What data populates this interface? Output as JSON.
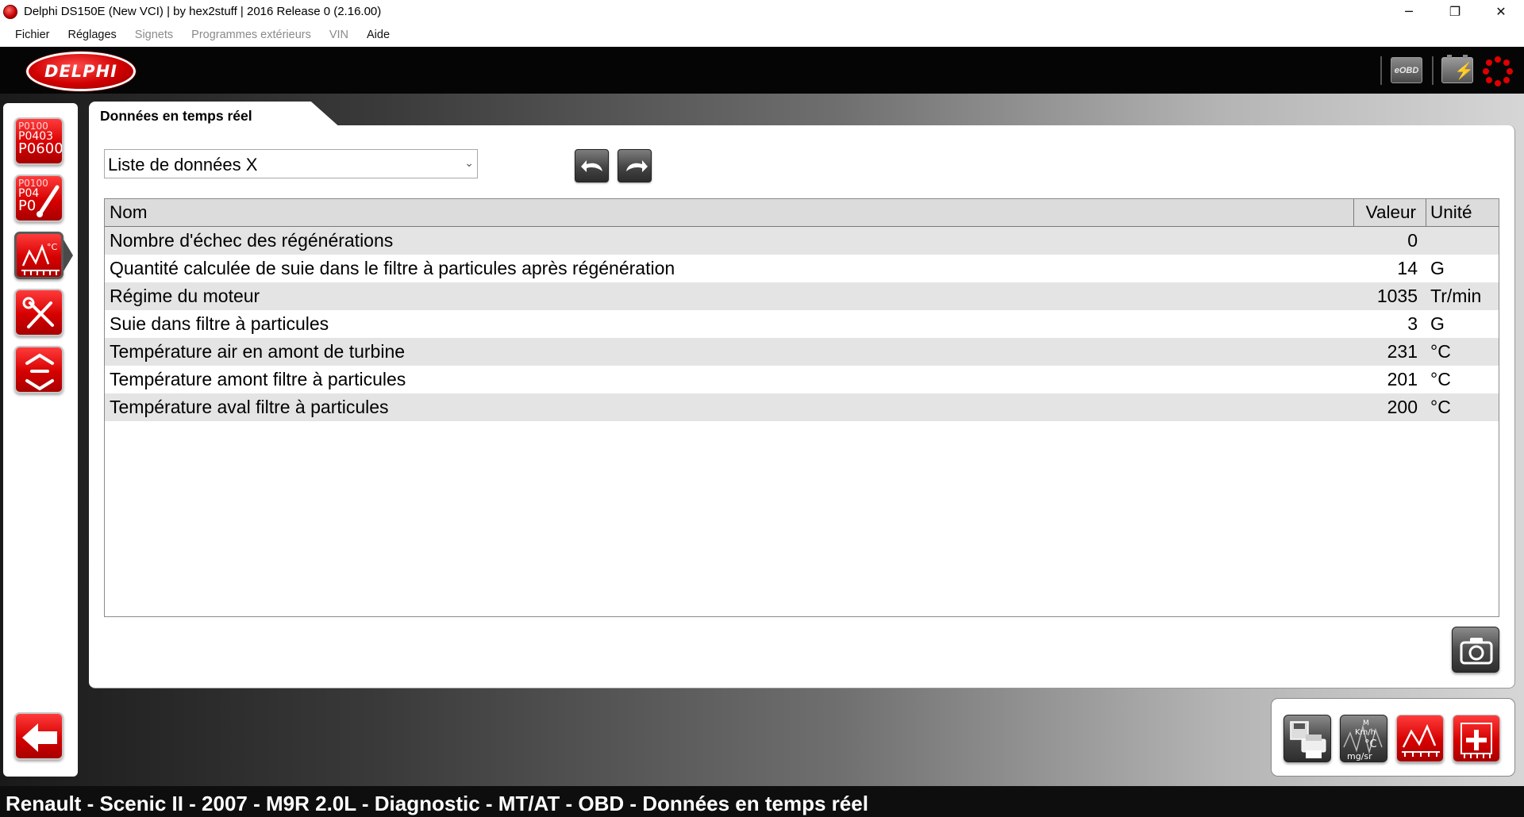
{
  "window": {
    "title": "Delphi DS150E (New VCI) | by hex2stuff | 2016 Release 0 (2.16.00)",
    "controls": {
      "minimize": "─",
      "restore": "❐",
      "close": "✕"
    }
  },
  "menu": {
    "items": [
      {
        "label": "Fichier",
        "enabled": true
      },
      {
        "label": "Réglages",
        "enabled": true
      },
      {
        "label": "Signets",
        "enabled": false
      },
      {
        "label": "Programmes extérieurs",
        "enabled": false
      },
      {
        "label": "VIN",
        "enabled": false
      },
      {
        "label": "Aide",
        "enabled": true
      }
    ]
  },
  "header": {
    "logo_text": "DELPHI",
    "eobd_label": "eOBD",
    "battery_icon": "battery-charging-icon",
    "status_icon": "connection-spinner-icon"
  },
  "sidebar": {
    "items": [
      {
        "name": "read-dtc-button",
        "codes": [
          "P0100",
          "P0403",
          "P0600"
        ],
        "icon": "dtc-codes-icon"
      },
      {
        "name": "clear-dtc-button",
        "codes": [
          "P0100",
          "P04",
          "P0"
        ],
        "icon": "erase-dtc-icon"
      },
      {
        "name": "live-data-button",
        "icon": "live-data-chart-icon",
        "active": true
      },
      {
        "name": "tests-button",
        "icon": "tools-icon"
      },
      {
        "name": "adjustments-button",
        "icon": "adjust-arrows-icon"
      }
    ],
    "back_icon": "back-arrow-icon"
  },
  "content": {
    "tab_label": "Données en temps réel",
    "data_list": {
      "selected": "Liste de données X"
    },
    "table": {
      "headers": {
        "name": "Nom",
        "value": "Valeur",
        "unit": "Unité"
      },
      "rows": [
        {
          "name": "Nombre d'échec des régénérations",
          "value": "0",
          "unit": ""
        },
        {
          "name": "Quantité calculée de suie dans le filtre à particules après régénération",
          "value": "14",
          "unit": "G"
        },
        {
          "name": "Régime du moteur",
          "value": "1035",
          "unit": "Tr/min"
        },
        {
          "name": "Suie dans filtre à particules",
          "value": "3",
          "unit": "G"
        },
        {
          "name": "Température air en amont de turbine",
          "value": "231",
          "unit": "°C"
        },
        {
          "name": "Température amont filtre à particules",
          "value": "201",
          "unit": "°C"
        },
        {
          "name": "Température aval filtre à particules",
          "value": "200",
          "unit": "°C"
        }
      ]
    }
  },
  "tools": {
    "items": [
      {
        "name": "save-print-button",
        "icon": "save-print-icon"
      },
      {
        "name": "units-button",
        "icon": "units-icon",
        "glyph_lines": [
          "M",
          "Km/h",
          "°C",
          "mg/sr"
        ]
      },
      {
        "name": "graph-button",
        "icon": "graph-icon"
      },
      {
        "name": "add-parameter-button",
        "icon": "add-parameter-icon"
      }
    ]
  },
  "status_bar": {
    "text": "Renault - Scenic II - 2007 - M9R 2.0L - Diagnostic - MT/AT - OBD - Données en temps réel"
  },
  "colors": {
    "brand_red": "#d60000",
    "header_bg": "#050505",
    "status_bg": "#0e0e0e",
    "row_alt": "#e4e4e4"
  }
}
